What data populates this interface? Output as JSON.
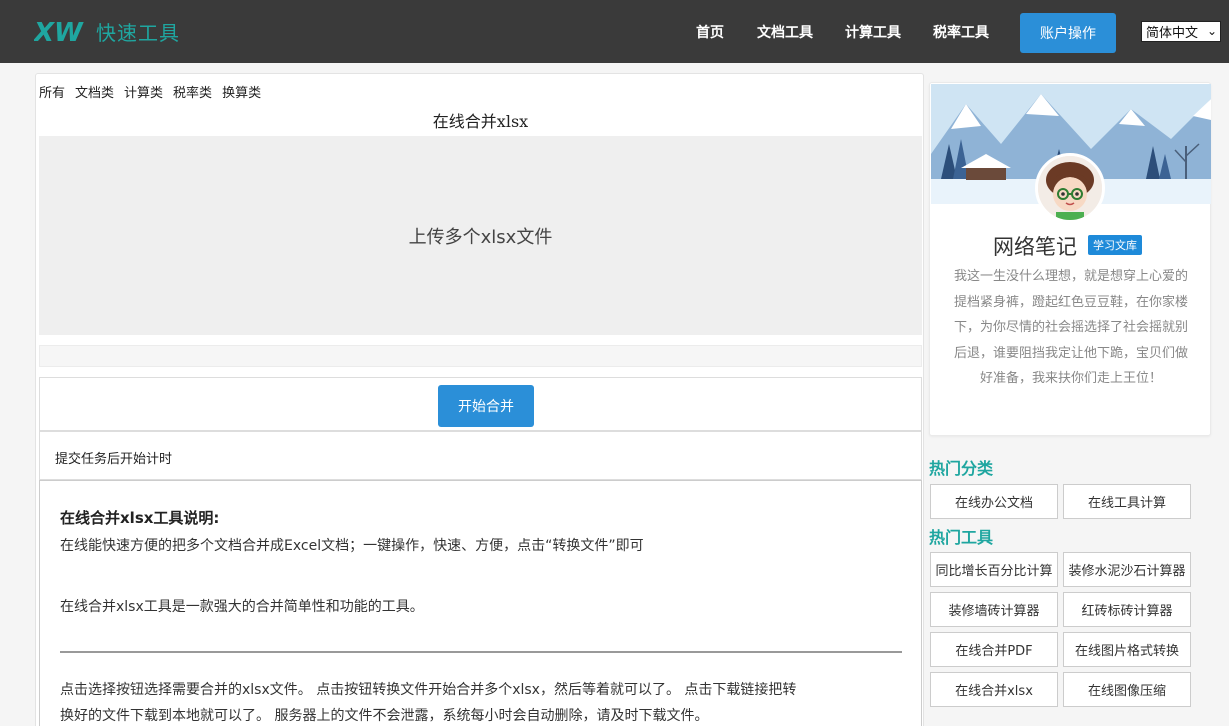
{
  "header": {
    "logo_mark": "XW",
    "logo_text": "快速工具",
    "nav": [
      "首页",
      "文档工具",
      "计算工具",
      "税率工具"
    ],
    "account_button": "账户操作",
    "language": "简体中文"
  },
  "main": {
    "category_tabs": [
      "所有",
      "文档类",
      "计算类",
      "税率类",
      "换算类"
    ],
    "tool_title": "在线合并xlsx",
    "upload_label": "上传多个xlsx文件",
    "merge_button": "开始合并",
    "timer_text": "提交任务后开始计时",
    "description": {
      "title": "在线合并xlsx工具说明:",
      "line1": "在线能快速方便的把多个文档合并成Excel文档；一键操作，快速、方便，点击“转换文件”即可",
      "line2": "在线合并xlsx工具是一款强大的合并简单性和功能的工具。",
      "line3a": "点击选择按钮选择需要合并的xlsx文件。 点击按钮转换文件开始合并多个xlsx，然后等着就可以了。 点击下载链接把转",
      "line3b": "换好的文件下载到本地就可以了。 服务器上的文件不会泄露，系统每小时会自动删除，请及时下载文件。"
    }
  },
  "sidebar": {
    "profile": {
      "name": "网络笔记",
      "badge": "学习文库",
      "bio": "我这一生没什么理想，就是想穿上心爱的提档紧身裤，蹬起红色豆豆鞋，在你家楼下，为你尽情的社会摇选择了社会摇就别后退，谁要阻挡我定让他下跪，宝贝们做好准备，我来扶你们走上王位！"
    },
    "hot_categories_title": "热门分类",
    "hot_categories": [
      "在线办公文档",
      "在线工具计算"
    ],
    "hot_tools_title": "热门工具",
    "hot_tools": [
      "同比增长百分比计算",
      "装修水泥沙石计算器",
      "装修墙砖计算器",
      "红砖标砖计算器",
      "在线合并PDF",
      "在线图片格式转换",
      "在线合并xlsx",
      "在线图像压缩"
    ]
  },
  "colors": {
    "header_bg": "#3a3a3a",
    "brand_teal": "#1fa6a0",
    "primary_blue": "#2b8fd8"
  }
}
